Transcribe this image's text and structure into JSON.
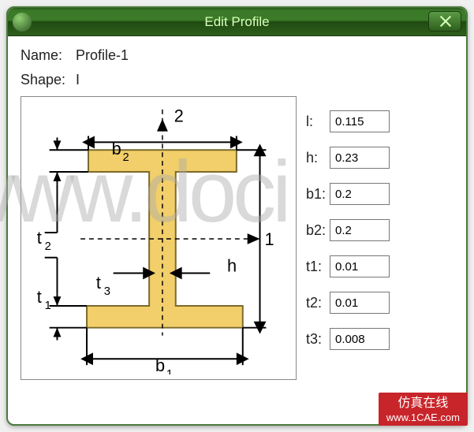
{
  "window": {
    "title": "Edit Profile"
  },
  "header": {
    "name_label": "Name:",
    "name_value": "Profile-1",
    "shape_label": "Shape:",
    "shape_value": "I"
  },
  "diagram": {
    "labels": {
      "axis2": "2",
      "axis1": "1",
      "b1": "b₁",
      "b2": "b₂",
      "h": "h",
      "t1": "t₁",
      "t2": "t₂",
      "t3": "t₃"
    }
  },
  "fields": {
    "l": {
      "label": "l:",
      "value": "0.115"
    },
    "h": {
      "label": "h:",
      "value": "0.23"
    },
    "b1": {
      "label": "b1:",
      "value": "0.2"
    },
    "b2": {
      "label": "b2:",
      "value": "0.2"
    },
    "t1": {
      "label": "t1:",
      "value": "0.01"
    },
    "t2": {
      "label": "t2:",
      "value": "0.01"
    },
    "t3": {
      "label": "t3:",
      "value": "0.008"
    }
  },
  "watermarks": {
    "big": "www.doci",
    "badge_line1": "仿真在线",
    "badge_line2": "www.1CAE.com"
  }
}
